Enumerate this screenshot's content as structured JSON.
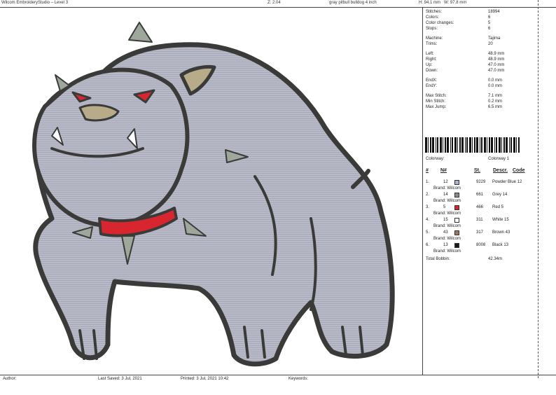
{
  "header": {
    "app_title": "Wilcom EmbroideryStudio – Level 3",
    "zoom": "Z: 2.04",
    "design_name": "gray pitbull bulldog 4 inch",
    "height": "H: 94.1 mm",
    "width": "W: 97.8 mm"
  },
  "stats": [
    {
      "label": "Stitches:",
      "value": "18994"
    },
    {
      "label": "Colors:",
      "value": "6"
    },
    {
      "label": "Color changes:",
      "value": "5"
    },
    {
      "label": "Stops:",
      "value": "6"
    },
    {
      "label": "Machine:",
      "value": "Tajima"
    },
    {
      "label": "Trims:",
      "value": "20"
    },
    {
      "label": "Left:",
      "value": "48.9 mm"
    },
    {
      "label": "Right:",
      "value": "48.9 mm"
    },
    {
      "label": "Up:",
      "value": "47.0 mm"
    },
    {
      "label": "Down:",
      "value": "47.0 mm"
    },
    {
      "label": "EndX:",
      "value": "0.0 mm"
    },
    {
      "label": "EndY:",
      "value": "0.0 mm"
    },
    {
      "label": "Max Stitch:",
      "value": "7.1 mm"
    },
    {
      "label": "Min Stitch:",
      "value": "0.2 mm"
    },
    {
      "label": "Max Jump:",
      "value": "6.5 mm"
    }
  ],
  "colorway": {
    "label": "Colorway:",
    "value": "Colorway 1"
  },
  "table_headers": {
    "num": "#",
    "n": "N#",
    "st": "St.",
    "descr": "Descr.",
    "code": "Code"
  },
  "colors": [
    {
      "idx": "1.",
      "n": "12",
      "swatch": "#aeb4d4",
      "st": "9229",
      "descr": "Powder Blue 12",
      "brand": "Brand: Wilcom"
    },
    {
      "idx": "2.",
      "n": "14",
      "swatch": "#8a8b8e",
      "st": "661",
      "descr": "Grey 14",
      "brand": "Brand: Wilcom"
    },
    {
      "idx": "3.",
      "n": "5",
      "swatch": "#d8262f",
      "st": "466",
      "descr": "Red 5",
      "brand": "Brand: Wilcom"
    },
    {
      "idx": "4.",
      "n": "15",
      "swatch": "#ffffff",
      "st": "311",
      "descr": "White 15",
      "brand": "Brand: Wilcom"
    },
    {
      "idx": "5.",
      "n": "43",
      "swatch": "#9b7a55",
      "st": "317",
      "descr": "Brown 43",
      "brand": "Brand: Wilcom"
    },
    {
      "idx": "6.",
      "n": "13",
      "swatch": "#1a1a1a",
      "st": "8008",
      "descr": "Black 13",
      "brand": "Brand: Wilcom"
    }
  ],
  "bobbin": {
    "label": "Total Bobbin:",
    "value": "42.34m"
  },
  "footer": {
    "author": "Author:",
    "last_saved": "Last Saved:  3 Jul, 2021",
    "printed": "Printed:  3 Jul, 2021 10:42",
    "keywords": "Keywords:"
  }
}
